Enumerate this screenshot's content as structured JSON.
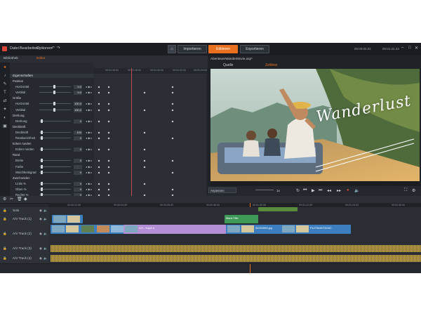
{
  "menu": {
    "items": [
      "Datei",
      "Bearbeiten",
      "Optionen"
    ]
  },
  "modes": {
    "import": "Importieren",
    "edit": "Editieren",
    "export": "Exportieren"
  },
  "timecodes": {
    "left": "00:00:02.01",
    "right": "00:01:22.23"
  },
  "left_tabs": {
    "library": "Bibliothek",
    "editor": "Editor"
  },
  "editor_tabs": [
    "Eigenschaften",
    "Media-Editor",
    "Farbe",
    "Effekt",
    "360°-Video",
    "Pan und Zoom",
    "Eingangs-Überblendung"
  ],
  "properties": {
    "header": "Eigenschaften",
    "rows": [
      {
        "label": "Position",
        "group": true
      },
      {
        "label": "Horizontal",
        "value": "0,0"
      },
      {
        "label": "Vertikal",
        "value": "0,0"
      },
      {
        "label": "Größe",
        "group": true
      },
      {
        "label": "Horizontal",
        "value": "100,0"
      },
      {
        "label": "Vertikal",
        "value": "100,0"
      },
      {
        "label": "Drehung",
        "group": true
      },
      {
        "label": "Drehung",
        "value": "0"
      },
      {
        "label": "Deckkraft",
        "group": true
      },
      {
        "label": "Deckkraft",
        "value": "100"
      },
      {
        "label": "Randweichheit",
        "value": "0"
      },
      {
        "label": "Ecken runden",
        "group": true
      },
      {
        "label": "Ecken runden",
        "value": "0"
      },
      {
        "label": "Rand",
        "group": true
      },
      {
        "label": "Breite",
        "value": "0"
      },
      {
        "label": "Farbe",
        "value": ""
      },
      {
        "label": "Weichheitsgrad",
        "value": "0"
      },
      {
        "label": "Zuschneiden",
        "group": true
      },
      {
        "label": "Links %",
        "value": "0"
      },
      {
        "label": "Oben %",
        "value": "0"
      },
      {
        "label": "Rechts %",
        "value": "0"
      }
    ]
  },
  "kf_ruler": [
    "00:01:16.00",
    "00:01:18.00",
    "00:01:20.00",
    "00:01:22.00",
    "00:01:24.00"
  ],
  "preview": {
    "title": "AbenteuerWanderMovie.axp*",
    "tabs": [
      "Quelle",
      "Zeitlinie"
    ],
    "overlay_text": "Wanderlust",
    "fit_select": "Anpassen",
    "speed": "1x"
  },
  "tracks": [
    {
      "name": "Solo",
      "type": "solo"
    },
    {
      "name": "A/V Track (1)"
    },
    {
      "name": "A/V Track (2)"
    },
    {
      "name": "A/V Track (3)"
    },
    {
      "name": "A/V Track (4)"
    }
  ],
  "clips": {
    "title_clip": "Blank Title",
    "track2_a": "A/V - Inspir A",
    "track2_b": "IMG02850.jpg",
    "track2_c": "P1275049/7524/C",
    "track1_right": "Blank Title"
  },
  "tl_ruler": [
    "00:00:12.00",
    "00:00:24.00",
    "00:00:36.00",
    "00:00:48.00",
    "00:01:00.00",
    "00:01:12.00",
    "00:01:24.00",
    "00:01:36.00"
  ],
  "colors": {
    "accent": "#e8701f",
    "clip_blue": "#3c7fc0",
    "clip_purple": "#b58fd6",
    "clip_green": "#3f9a5a",
    "audio": "#c9a84a"
  }
}
